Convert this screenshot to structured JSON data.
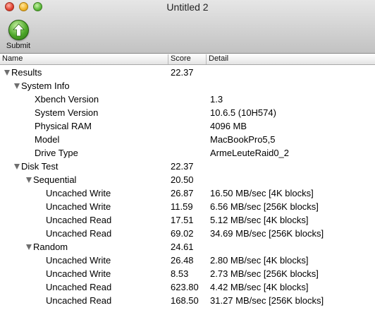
{
  "window": {
    "title": "Untitled 2"
  },
  "toolbar": {
    "submit_label": "Submit"
  },
  "columns": {
    "name": "Name",
    "score": "Score",
    "detail": "Detail"
  },
  "rows": [
    {
      "name": "Results",
      "score": "22.37",
      "detail": ""
    },
    {
      "name": "System Info",
      "score": "",
      "detail": ""
    },
    {
      "name": "Xbench Version",
      "score": "",
      "detail": "1.3"
    },
    {
      "name": "System Version",
      "score": "",
      "detail": "10.6.5 (10H574)"
    },
    {
      "name": "Physical RAM",
      "score": "",
      "detail": "4096 MB"
    },
    {
      "name": "Model",
      "score": "",
      "detail": "MacBookPro5,5"
    },
    {
      "name": "Drive Type",
      "score": "",
      "detail": "ArmeLeuteRaid0_2"
    },
    {
      "name": "Disk Test",
      "score": "22.37",
      "detail": ""
    },
    {
      "name": "Sequential",
      "score": "20.50",
      "detail": ""
    },
    {
      "name": "Uncached Write",
      "score": "26.87",
      "detail": "16.50 MB/sec [4K blocks]"
    },
    {
      "name": "Uncached Write",
      "score": "11.59",
      "detail": "6.56 MB/sec [256K blocks]"
    },
    {
      "name": "Uncached Read",
      "score": "17.51",
      "detail": "5.12 MB/sec [4K blocks]"
    },
    {
      "name": "Uncached Read",
      "score": "69.02",
      "detail": "34.69 MB/sec [256K blocks]"
    },
    {
      "name": "Random",
      "score": "24.61",
      "detail": ""
    },
    {
      "name": "Uncached Write",
      "score": "26.48",
      "detail": "2.80 MB/sec [4K blocks]"
    },
    {
      "name": "Uncached Write",
      "score": "8.53",
      "detail": "2.73 MB/sec [256K blocks]"
    },
    {
      "name": "Uncached Read",
      "score": "623.80",
      "detail": "4.42 MB/sec [4K blocks]"
    },
    {
      "name": "Uncached Read",
      "score": "168.50",
      "detail": "31.27 MB/sec [256K blocks]"
    }
  ]
}
